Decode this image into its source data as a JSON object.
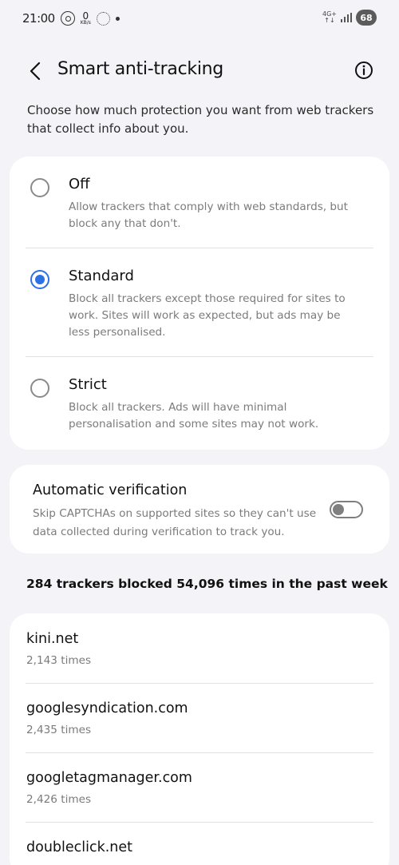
{
  "status_bar": {
    "time": "21:00",
    "speed_value": "0",
    "speed_unit": "KB/s",
    "network": "4G+",
    "battery": "68"
  },
  "header": {
    "title": "Smart anti-tracking"
  },
  "intro": "Choose how much protection you want from web trackers that collect info about you.",
  "options": [
    {
      "title": "Off",
      "description": "Allow trackers that comply with web standards, but block any that don't.",
      "selected": false
    },
    {
      "title": "Standard",
      "description": "Block all trackers except those required for sites to work. Sites will work as expected, but ads may be less personalised.",
      "selected": true
    },
    {
      "title": "Strict",
      "description": "Block all trackers. Ads will have minimal personalisation and some sites may not work.",
      "selected": false
    }
  ],
  "verification": {
    "title": "Automatic verification",
    "description": "Skip CAPTCHAs on supported sites so they can't use data collected during verification to track you.",
    "enabled": false
  },
  "summary": "284 trackers blocked 54,096 times in the past week",
  "trackers": [
    {
      "domain": "kini.net",
      "count": "2,143 times"
    },
    {
      "domain": "googlesyndication.com",
      "count": "2,435 times"
    },
    {
      "domain": "googletagmanager.com",
      "count": "2,426 times"
    },
    {
      "domain": "doubleclick.net",
      "count": ""
    }
  ],
  "colors": {
    "accent": "#2f6fe4",
    "background": "#f4f3f7",
    "card": "#ffffff",
    "secondary_text": "#7b7b7b"
  }
}
